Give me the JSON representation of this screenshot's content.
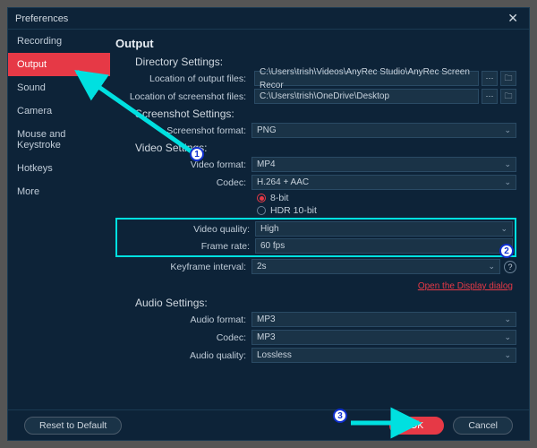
{
  "window": {
    "title": "Preferences"
  },
  "sidebar": {
    "items": [
      {
        "label": "Recording"
      },
      {
        "label": "Output"
      },
      {
        "label": "Sound"
      },
      {
        "label": "Camera"
      },
      {
        "label": "Mouse and Keystroke"
      },
      {
        "label": "Hotkeys"
      },
      {
        "label": "More"
      }
    ],
    "activeIndex": 1
  },
  "page": {
    "title": "Output",
    "directory": {
      "heading": "Directory Settings:",
      "output_label": "Location of output files:",
      "output_path": "C:\\Users\\trish\\Videos\\AnyRec Studio\\AnyRec Screen Recor",
      "screenshot_label": "Location of screenshot files:",
      "screenshot_path": "C:\\Users\\trish\\OneDrive\\Desktop"
    },
    "screenshot": {
      "heading": "Screenshot Settings:",
      "format_label": "Screenshot format:",
      "format": "PNG"
    },
    "video": {
      "heading": "Video Settings:",
      "format_label": "Video format:",
      "format": "MP4",
      "codec_label": "Codec:",
      "codec": "H.264 + AAC",
      "bit8": "8-bit",
      "hdr": "HDR 10-bit",
      "quality_label": "Video quality:",
      "quality": "High",
      "framerate_label": "Frame rate:",
      "framerate": "60 fps",
      "keyframe_label": "Keyframe interval:",
      "keyframe": "2s",
      "link": "Open the Display dialog"
    },
    "audio": {
      "heading": "Audio Settings:",
      "format_label": "Audio format:",
      "format": "MP3",
      "codec_label": "Codec:",
      "codec": "MP3",
      "quality_label": "Audio quality:",
      "quality": "Lossless"
    }
  },
  "footer": {
    "reset": "Reset to Default",
    "ok": "OK",
    "cancel": "Cancel"
  },
  "annotations": {
    "b1": "1",
    "b2": "2",
    "b3": "3"
  }
}
